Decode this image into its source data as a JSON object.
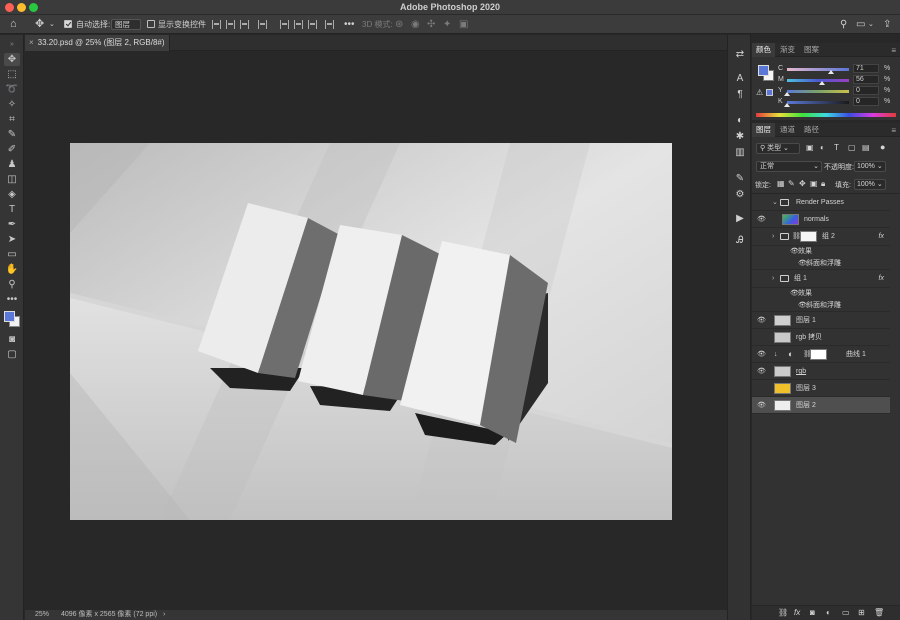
{
  "app": {
    "title": "Adobe Photoshop 2020"
  },
  "options_bar": {
    "auto_select_label": "自动选择:",
    "auto_select_target": "图层",
    "show_transform_label": "显示变换控件",
    "mode3d_label": "3D 模式:"
  },
  "document": {
    "tab_title": "33.20.psd @ 25% (图层 2, RGB/8#) *",
    "zoom": "25%",
    "size_info": "4096 像素 x 2565 像素 (72 ppi)"
  },
  "color_panel": {
    "tabs": [
      "颜色",
      "渐变",
      "图案"
    ],
    "fg_color": "#5b78d8",
    "sliders": [
      {
        "label": "C",
        "value": "71",
        "unit": "%",
        "level": 0.71
      },
      {
        "label": "M",
        "value": "56",
        "unit": "%",
        "level": 0.56
      },
      {
        "label": "Y",
        "value": "0",
        "unit": "%",
        "level": 0.0
      },
      {
        "label": "K",
        "value": "0",
        "unit": "%",
        "level": 0.0
      }
    ]
  },
  "layers_panel": {
    "tabs": [
      "图层",
      "通道",
      "路径"
    ],
    "filter_kind": "类型",
    "blend_mode": "正常",
    "opacity_label": "不透明度:",
    "opacity_value": "100%",
    "lock_label": "锁定:",
    "fill_label": "填充:",
    "fill_value": "100%",
    "layers": [
      {
        "name": "Render Passes",
        "kind": "group-open"
      },
      {
        "name": "normals",
        "kind": "normals"
      },
      {
        "name": "组 2",
        "kind": "group-fx"
      },
      {
        "name": "效果",
        "kind": "effect-head"
      },
      {
        "name": "斜面和浮雕",
        "kind": "effect"
      },
      {
        "name": "组 1",
        "kind": "group-fx-2"
      },
      {
        "name": "效果",
        "kind": "effect-head"
      },
      {
        "name": "斜面和浮雕",
        "kind": "effect"
      },
      {
        "name": "图层 1",
        "kind": "layer"
      },
      {
        "name": "rgb 拷贝",
        "kind": "layer-hidden"
      },
      {
        "name": "曲线 1",
        "kind": "adjust"
      },
      {
        "name": "rgb",
        "kind": "layer-link"
      },
      {
        "name": "图层 3",
        "kind": "fill-yellow"
      },
      {
        "name": "图层 2",
        "kind": "selected"
      }
    ],
    "fx_symbol": "fx"
  }
}
